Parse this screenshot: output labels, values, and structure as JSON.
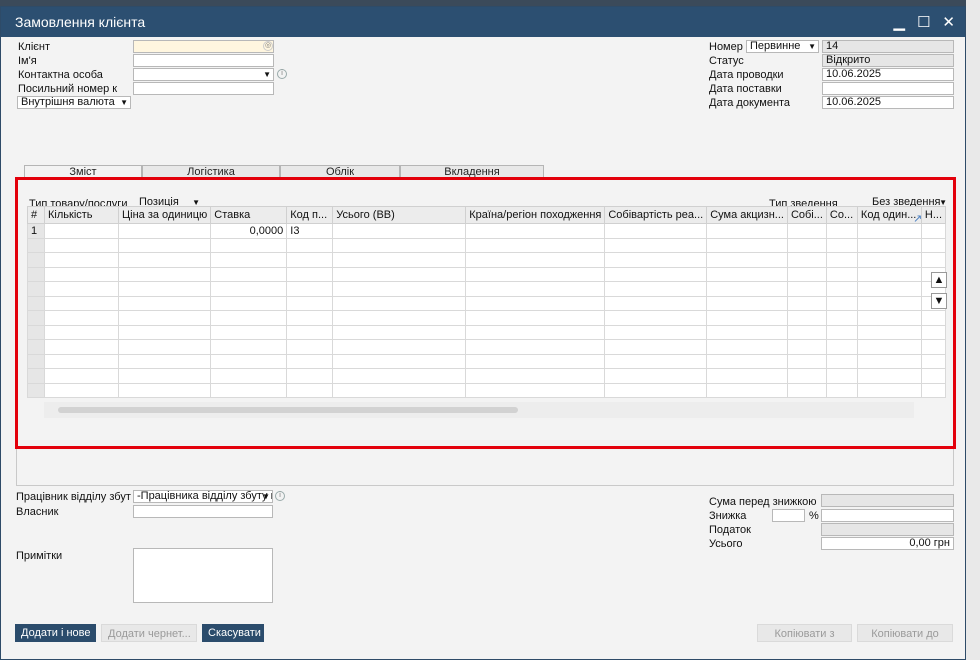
{
  "window": {
    "title": "Замовлення клієнта"
  },
  "header_left": {
    "client_label": "Клієнт",
    "client_value": "",
    "name_label": "Ім'я",
    "name_value": "",
    "contact_label": "Контактна особа",
    "contact_value": "",
    "reference_label": "Посильний номер к",
    "reference_value": "",
    "currency_value": "Внутрішня валюта"
  },
  "header_right": {
    "number_label": "Номер",
    "number_series": "Первинне",
    "number_value": "14",
    "status_label": "Статус",
    "status_value": "Відкрито",
    "posting_date_label": "Дата проводки",
    "posting_date_value": "10.06.2025",
    "delivery_date_label": "Дата поставки",
    "delivery_date_value": "",
    "document_date_label": "Дата документа",
    "document_date_value": "10.06.2025"
  },
  "tabs": [
    "Зміст",
    "Логістика",
    "Облік",
    "Вкладення"
  ],
  "contents": {
    "item_type_label": "Тип товару/послуги",
    "item_type_value": "Позиція",
    "summary_type_label": "Тип зведення",
    "summary_type_value": "Без зведення"
  },
  "grid": {
    "columns": [
      "#",
      "Кількість",
      "Ціна за одиницю",
      "Ставка",
      "Код п...",
      "Усього (ВВ)",
      "Країна/регіон походження",
      "Собівартість реа...",
      "Сума акцизн...",
      "Собі...",
      "Со...",
      "Код один...",
      "Н..."
    ],
    "rows": [
      [
        "1",
        "",
        "",
        "0,0000",
        "I3",
        "",
        "",
        "",
        "",
        "",
        "",
        "",
        ""
      ]
    ]
  },
  "footer_left": {
    "sales_employee_label": "Працівник відділу збут",
    "sales_employee_value": "-Працівника відділу збуту нем",
    "owner_label": "Власник",
    "owner_value": "",
    "remarks_label": "Примітки",
    "remarks_value": ""
  },
  "footer_right": {
    "before_discount_label": "Сума перед знижкою",
    "before_discount_value": "",
    "discount_label": "Знижка",
    "discount_percent_value": "",
    "percent_sign": "%",
    "discount_value": "",
    "tax_label": "Податок",
    "tax_value": "",
    "total_label": "Усього",
    "total_value": "0,00 грн"
  },
  "buttons": {
    "add_new": "Додати і нове",
    "add_draft": "Додати чернет...",
    "cancel": "Скасувати",
    "copy_from": "Копіювати з",
    "copy_to": "Копіювати до"
  },
  "colors": {
    "titlebar": "#2c4f71",
    "highlight": "#e3000b",
    "dark_button": "#2b4c6c"
  }
}
